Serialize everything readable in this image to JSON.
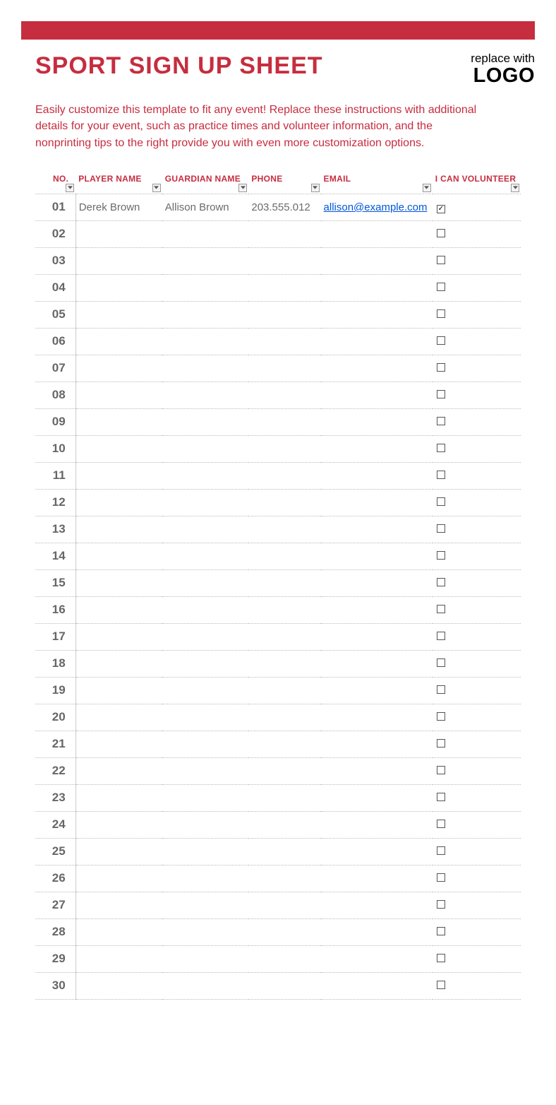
{
  "header": {
    "title": "SPORT SIGN UP SHEET",
    "logo_small": "replace with",
    "logo_big": "LOGO"
  },
  "intro": "Easily customize this template to fit any event! Replace these instructions with additional details for your event, such as practice times and volunteer information, and the nonprinting tips to the right provide you with even more customization options.",
  "columns": {
    "no": "NO.",
    "player": "PLAYER NAME",
    "guardian": "GUARDIAN NAME",
    "phone": "PHONE",
    "email": "EMAIL",
    "volunteer": "I CAN VOLUNTEER"
  },
  "rows": [
    {
      "no": "01",
      "player": "Derek Brown",
      "guardian": "Allison Brown",
      "phone": "203.555.012",
      "email": "allison@example.com",
      "vol": true
    },
    {
      "no": "02",
      "player": "",
      "guardian": "",
      "phone": "",
      "email": "",
      "vol": false
    },
    {
      "no": "03",
      "player": "",
      "guardian": "",
      "phone": "",
      "email": "",
      "vol": false
    },
    {
      "no": "04",
      "player": "",
      "guardian": "",
      "phone": "",
      "email": "",
      "vol": false
    },
    {
      "no": "05",
      "player": "",
      "guardian": "",
      "phone": "",
      "email": "",
      "vol": false
    },
    {
      "no": "06",
      "player": "",
      "guardian": "",
      "phone": "",
      "email": "",
      "vol": false
    },
    {
      "no": "07",
      "player": "",
      "guardian": "",
      "phone": "",
      "email": "",
      "vol": false
    },
    {
      "no": "08",
      "player": "",
      "guardian": "",
      "phone": "",
      "email": "",
      "vol": false
    },
    {
      "no": "09",
      "player": "",
      "guardian": "",
      "phone": "",
      "email": "",
      "vol": false
    },
    {
      "no": "10",
      "player": "",
      "guardian": "",
      "phone": "",
      "email": "",
      "vol": false
    },
    {
      "no": "11",
      "player": "",
      "guardian": "",
      "phone": "",
      "email": "",
      "vol": false
    },
    {
      "no": "12",
      "player": "",
      "guardian": "",
      "phone": "",
      "email": "",
      "vol": false
    },
    {
      "no": "13",
      "player": "",
      "guardian": "",
      "phone": "",
      "email": "",
      "vol": false
    },
    {
      "no": "14",
      "player": "",
      "guardian": "",
      "phone": "",
      "email": "",
      "vol": false
    },
    {
      "no": "15",
      "player": "",
      "guardian": "",
      "phone": "",
      "email": "",
      "vol": false
    },
    {
      "no": "16",
      "player": "",
      "guardian": "",
      "phone": "",
      "email": "",
      "vol": false
    },
    {
      "no": "17",
      "player": "",
      "guardian": "",
      "phone": "",
      "email": "",
      "vol": false
    },
    {
      "no": "18",
      "player": "",
      "guardian": "",
      "phone": "",
      "email": "",
      "vol": false
    },
    {
      "no": "19",
      "player": "",
      "guardian": "",
      "phone": "",
      "email": "",
      "vol": false
    },
    {
      "no": "20",
      "player": "",
      "guardian": "",
      "phone": "",
      "email": "",
      "vol": false
    },
    {
      "no": "21",
      "player": "",
      "guardian": "",
      "phone": "",
      "email": "",
      "vol": false
    },
    {
      "no": "22",
      "player": "",
      "guardian": "",
      "phone": "",
      "email": "",
      "vol": false
    },
    {
      "no": "23",
      "player": "",
      "guardian": "",
      "phone": "",
      "email": "",
      "vol": false
    },
    {
      "no": "24",
      "player": "",
      "guardian": "",
      "phone": "",
      "email": "",
      "vol": false
    },
    {
      "no": "25",
      "player": "",
      "guardian": "",
      "phone": "",
      "email": "",
      "vol": false
    },
    {
      "no": "26",
      "player": "",
      "guardian": "",
      "phone": "",
      "email": "",
      "vol": false
    },
    {
      "no": "27",
      "player": "",
      "guardian": "",
      "phone": "",
      "email": "",
      "vol": false
    },
    {
      "no": "28",
      "player": "",
      "guardian": "",
      "phone": "",
      "email": "",
      "vol": false
    },
    {
      "no": "29",
      "player": "",
      "guardian": "",
      "phone": "",
      "email": "",
      "vol": false
    },
    {
      "no": "30",
      "player": "",
      "guardian": "",
      "phone": "",
      "email": "",
      "vol": false
    }
  ]
}
